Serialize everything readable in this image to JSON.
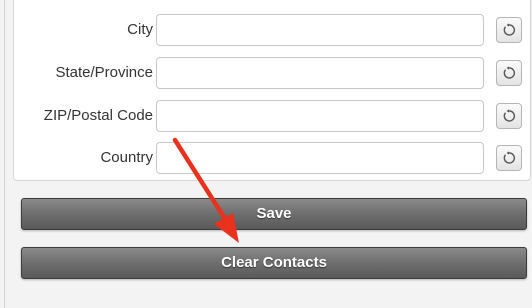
{
  "form": {
    "fields": [
      {
        "label": "City",
        "value": ""
      },
      {
        "label": "State/Province",
        "value": ""
      },
      {
        "label": "ZIP/Postal Code",
        "value": ""
      },
      {
        "label": "Country",
        "value": ""
      }
    ],
    "reset_icon": "reset-icon"
  },
  "actions": {
    "save_label": "Save",
    "clear_contacts_label": "Clear Contacts"
  },
  "colors": {
    "annotation_arrow": "#e8321e",
    "button_background": "#6e6e6e",
    "page_background": "#f3f3f3"
  }
}
